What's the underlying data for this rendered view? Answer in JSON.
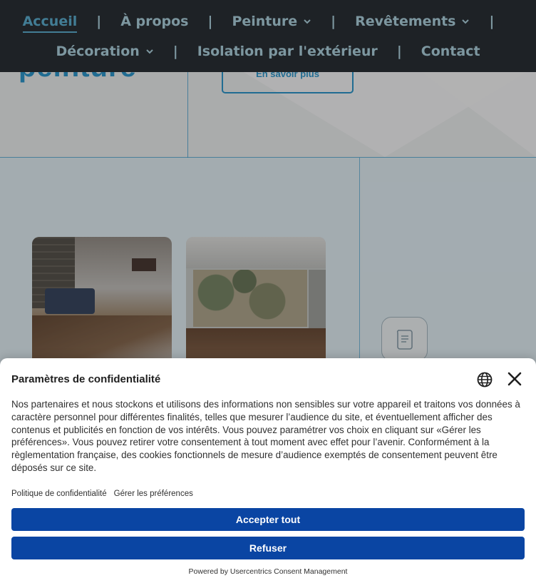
{
  "nav": {
    "row1": [
      {
        "label": "Accueil",
        "active": true,
        "dropdown": false
      },
      {
        "label": "À propos",
        "active": false,
        "dropdown": false
      },
      {
        "label": "Peinture",
        "active": false,
        "dropdown": true
      },
      {
        "label": "Revêtements",
        "active": false,
        "dropdown": true
      }
    ],
    "row2": [
      {
        "label": "Décoration",
        "active": false,
        "dropdown": true
      },
      {
        "label": "Isolation par l'extérieur",
        "active": false,
        "dropdown": false
      },
      {
        "label": "Contact",
        "active": false,
        "dropdown": false
      }
    ],
    "separator": "|"
  },
  "hero": {
    "word": "peinture",
    "button_label": "En savoir plus"
  },
  "consent": {
    "title": "Paramètres de confidentialité",
    "body": "Nos partenaires et nous stockons et utilisons des informations non sensibles sur votre appareil et traitons vos données à caractère personnel pour différentes finalités, telles que mesurer l’audience du site, et éventuellement afficher des contenus et publicités en fonction de vos intérêts. Vous pouvez paramétrer vos choix en cliquant sur «Gérer les préférences». Vous pouvez retirer votre consentement à tout moment avec effet pour l’avenir. Conformément à la règlementation française, des cookies fonctionnels de mesure d’audience exemptés de consentement peuvent être déposés sur ce site.",
    "links": {
      "privacy_policy": "Politique de confidentialité",
      "manage_preferences": "Gérer les préférences"
    },
    "accept_label": "Accepter tout",
    "refuse_label": "Refuser",
    "powered_by": "Powered by Usercentrics Consent Management"
  },
  "icons": {
    "language": "globe-icon",
    "close": "close-icon",
    "dropdown": "chevron-down-icon",
    "document": "document-icon"
  },
  "colors": {
    "nav_bg": "#2b3137",
    "nav_text": "#b4d9e6",
    "nav_active": "#5fb4d6",
    "brand_blue": "#2f9bd1",
    "button_bg": "#0a45a3",
    "button_text": "#ffffff"
  }
}
